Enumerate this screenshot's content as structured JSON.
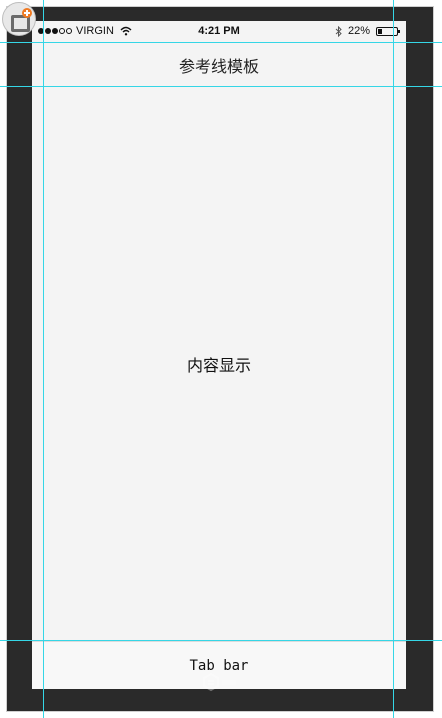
{
  "status_bar": {
    "carrier": "VIRGIN",
    "signal_filled": 3,
    "signal_total": 5,
    "time": "4:21 PM",
    "battery_percent": "22%",
    "battery_level": 0.22
  },
  "nav_bar": {
    "title": "参考线模板"
  },
  "content": {
    "label": "内容显示"
  },
  "tab_bar": {
    "label": "Tab bar"
  },
  "icons": {
    "app_badge": "add-artboard-icon",
    "wifi": "wifi-icon",
    "bluetooth": "bluetooth-icon",
    "battery": "battery-icon",
    "watermark": "logo-watermark-icon"
  },
  "colors": {
    "guide": "#35d6e6",
    "canvas": "#2a2a2a",
    "screen": "#f4f4f4",
    "badge_accent": "#f07a22"
  }
}
